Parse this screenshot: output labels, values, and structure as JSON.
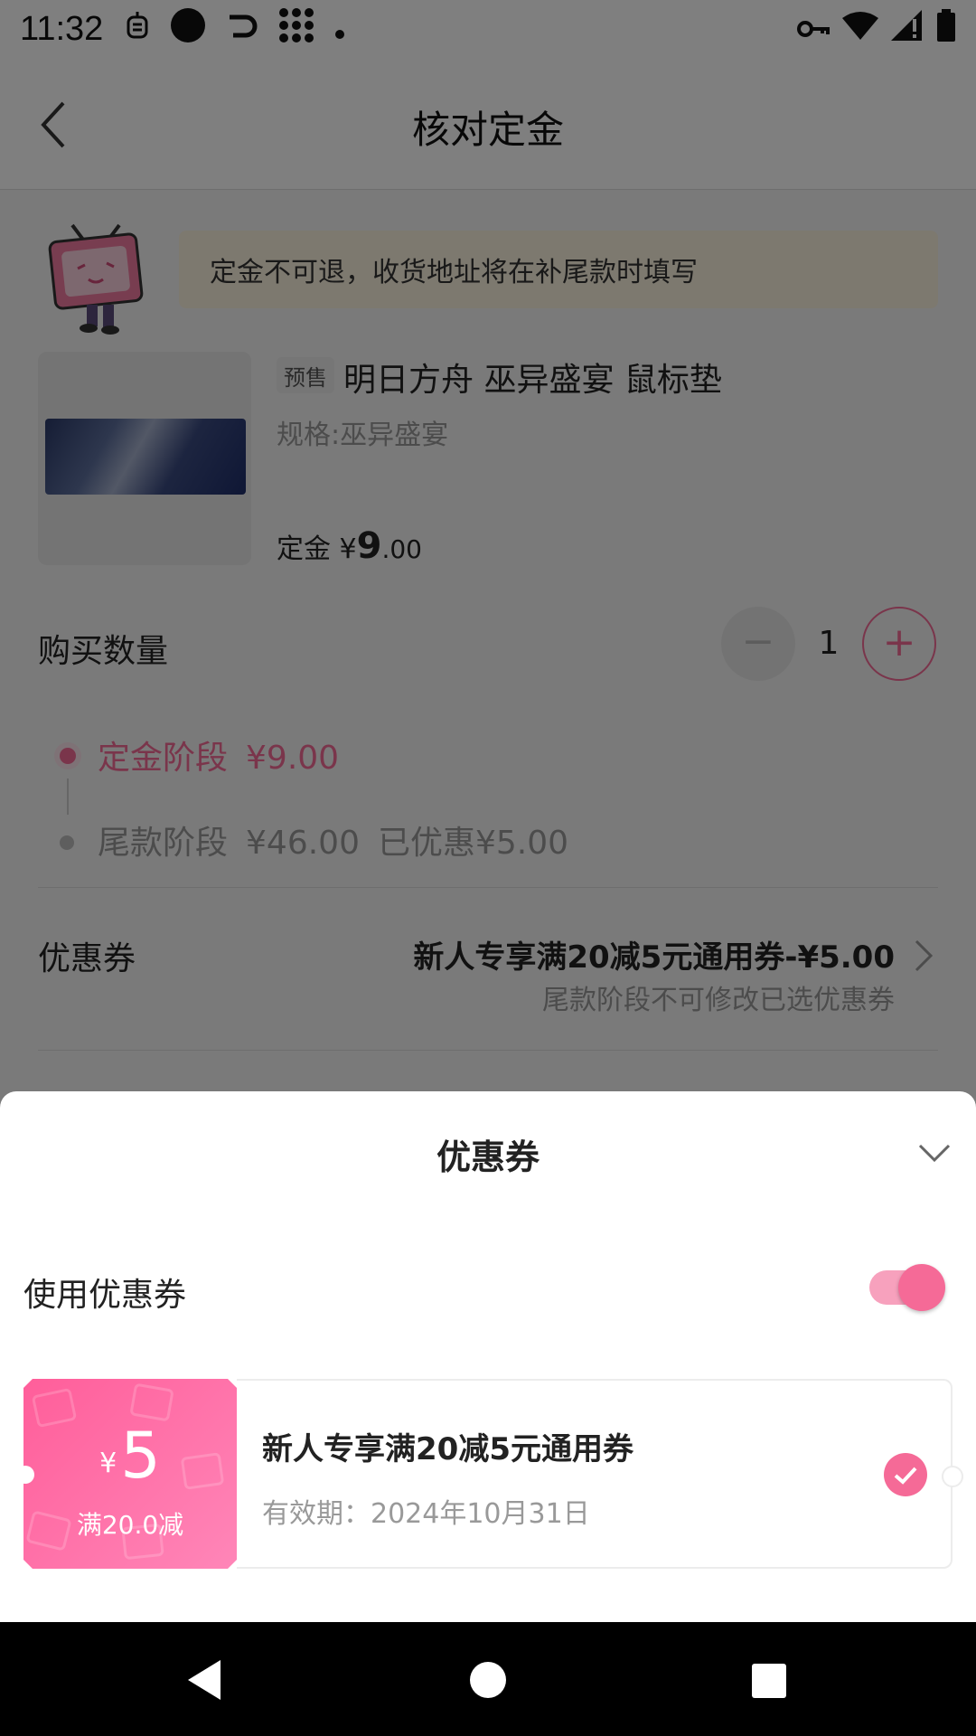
{
  "status_bar": {
    "time": "11:32"
  },
  "header": {
    "title": "核对定金"
  },
  "notice": {
    "text": "定金不可退，收货地址将在补尾款时填写"
  },
  "product": {
    "tag": "预售",
    "name": "明日方舟 巫异盛宴 鼠标垫",
    "spec": "规格:巫异盛宴",
    "deposit_label": "定金 ¥",
    "deposit_int": "9",
    "deposit_dec": ".00"
  },
  "quantity": {
    "label": "购买数量",
    "value": "1",
    "minus": "−",
    "plus": "+"
  },
  "stages": {
    "deposit": {
      "label": "定金阶段",
      "amount": "¥9.00"
    },
    "final": {
      "label": "尾款阶段",
      "amount": "¥46.00",
      "discount": "已优惠¥5.00"
    }
  },
  "coupon_row": {
    "label": "优惠券",
    "value": "新人专享满20减5元通用券-¥5.00",
    "note": "尾款阶段不可修改已选优惠券"
  },
  "sheet": {
    "title": "优惠券",
    "use_coupon_label": "使用优惠券",
    "use_coupon_on": true,
    "coupon": {
      "currency": "¥",
      "amount": "5",
      "condition": "满20.0减",
      "name": "新人专享满20减5元通用券",
      "expiry": "有效期：2024年10月31日",
      "selected": true
    }
  },
  "colors": {
    "accent": "#f56a97",
    "notice_bg": "#fbf2df"
  }
}
